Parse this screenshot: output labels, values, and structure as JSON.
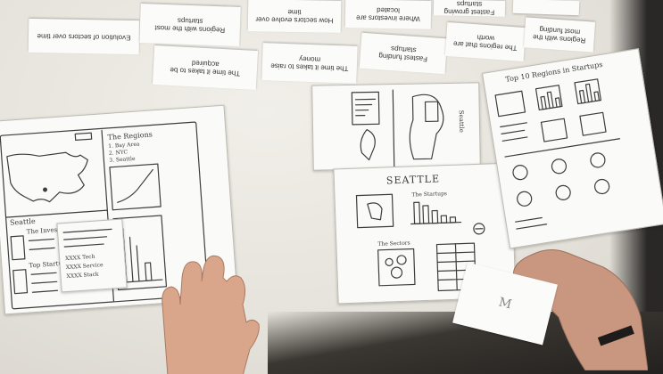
{
  "scene": {
    "description_colors": {
      "table": "#e6e3dc",
      "paper": "#fafaf8",
      "ink": "#3d3d3d",
      "skin": "#d9a68c",
      "floor": "#1e1c1a"
    }
  },
  "cards": [
    {
      "id": "card-evolution",
      "text": "Evolution of sectors over time"
    },
    {
      "id": "card-regions-startups",
      "text": "Regions with the most startups"
    },
    {
      "id": "card-sectors-money",
      "text": "How sectors evolve over time"
    },
    {
      "id": "card-investors",
      "text": "Where investors are located"
    },
    {
      "id": "card-fastest-growing",
      "text": "Fastest growing startups"
    },
    {
      "id": "card-time-acquired",
      "text": "The time it takes to be acquired"
    },
    {
      "id": "card-time-money",
      "text": "The time it takes to raise money"
    },
    {
      "id": "card-fastest-funding",
      "text": "Fastest funding startups"
    },
    {
      "id": "card-region-worth",
      "text": "The regions that are worth"
    },
    {
      "id": "card-regions-most",
      "text": "Regions with the most funding"
    }
  ],
  "sketch_left": {
    "regions_title": "The Regions",
    "regions_list": [
      "1. Bay Area",
      "2. NYC",
      "3. Seattle"
    ],
    "seattle_label": "Seattle",
    "investors_label": "The Investors",
    "top_startups_label": "Top Startups",
    "table_rows": [
      "XXXX Tech",
      "XXXX Service",
      "XXXX Stack"
    ]
  },
  "sketch_middle": {
    "title": "SEATTLE",
    "startups_label": "The Startups",
    "sectors_label": "The Sectors",
    "side_label": "Seattle"
  },
  "sketch_right": {
    "title": "Top 10 Regions in Startups"
  },
  "note_card": {
    "text": "M"
  }
}
